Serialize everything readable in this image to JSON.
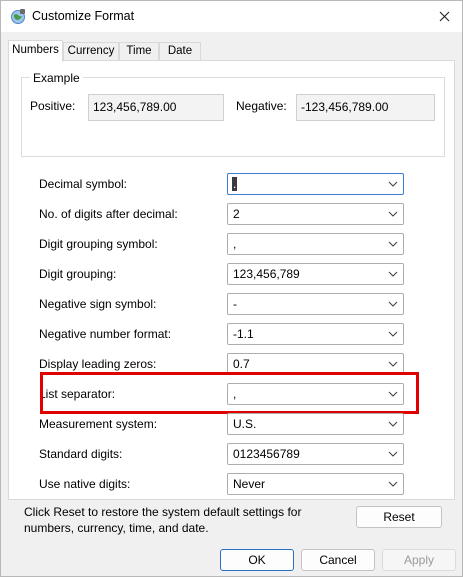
{
  "window": {
    "title": "Customize Format"
  },
  "tabs": [
    {
      "label": "Numbers"
    },
    {
      "label": "Currency"
    },
    {
      "label": "Time"
    },
    {
      "label": "Date"
    }
  ],
  "example": {
    "legend": "Example",
    "positive_label": "Positive:",
    "positive_value": "123,456,789.00",
    "negative_label": "Negative:",
    "negative_value": "-123,456,789.00"
  },
  "settings": [
    {
      "label": "Decimal symbol:",
      "value": "."
    },
    {
      "label": "No. of digits after decimal:",
      "value": "2"
    },
    {
      "label": "Digit grouping symbol:",
      "value": ","
    },
    {
      "label": "Digit grouping:",
      "value": "123,456,789"
    },
    {
      "label": "Negative sign symbol:",
      "value": "-"
    },
    {
      "label": "Negative number format:",
      "value": "-1.1"
    },
    {
      "label": "Display leading zeros:",
      "value": "0.7"
    },
    {
      "label": "List separator:",
      "value": ","
    },
    {
      "label": "Measurement system:",
      "value": "U.S."
    },
    {
      "label": "Standard digits:",
      "value": "0123456789"
    },
    {
      "label": "Use native digits:",
      "value": "Never"
    }
  ],
  "footer": {
    "reset_note": "Click Reset to restore the system default settings for numbers, currency, time, and date.",
    "reset_label": "Reset"
  },
  "buttons": {
    "ok": "OK",
    "cancel": "Cancel",
    "apply": "Apply"
  },
  "colors": {
    "highlight": "#e00000",
    "focus_border": "#3b7dd6"
  }
}
